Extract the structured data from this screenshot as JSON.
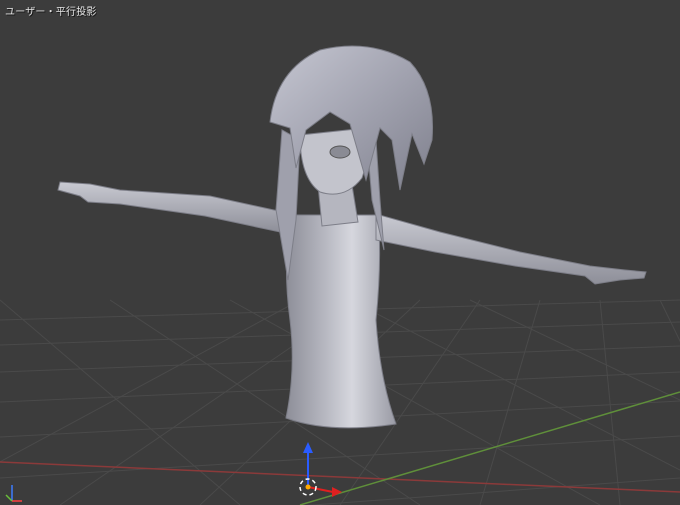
{
  "viewport": {
    "view_label": "ユーザー・平行投影",
    "background_color": "#3c3c3c",
    "grid_color": "#4a4a4a",
    "x_axis_color": "#8b3a3a",
    "y_axis_color": "#5f8f3a",
    "model_color": "#a9aab3",
    "gizmo": {
      "z_arrow_color": "#2a5cff",
      "x_arrow_color": "#e02020",
      "cursor_icon": "3d-cursor-icon"
    },
    "mini_axes_icon": "axis-orientation-icon"
  }
}
